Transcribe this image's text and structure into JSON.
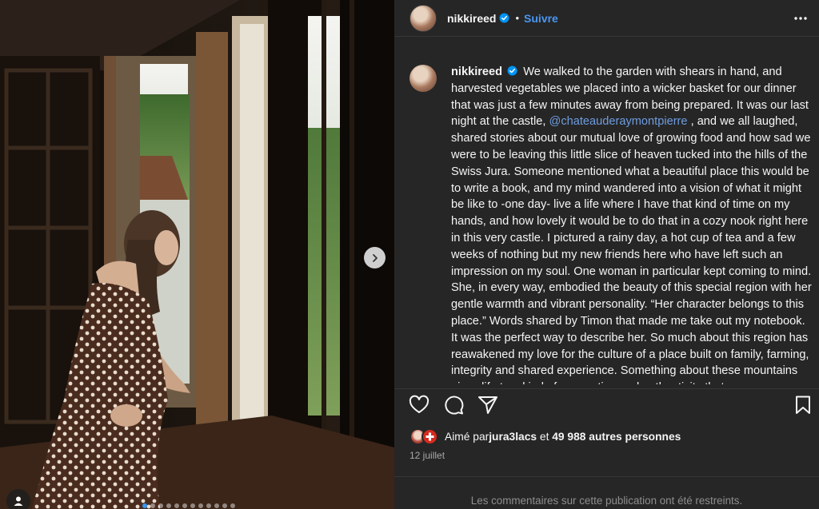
{
  "post": {
    "username": "nikkireed",
    "dot": "•",
    "follow_label": "Suivre",
    "more_icon": "more-horizontal-icon",
    "verified_icon": "verified-badge-icon"
  },
  "caption": {
    "author": "nikkireed",
    "text_before_mention": "We walked to the garden with shears in hand, and harvested vegetables we placed into a wicker basket for our dinner that was just a few minutes away from being prepared. It was our last night at the castle, ",
    "mention": "@chateauderaymontpierre",
    "text_after_mention": " , and we all laughed, shared stories about our mutual love of growing food and how sad we were to be leaving this little slice of heaven tucked into the hills of the Swiss Jura. Someone mentioned what a beautiful place this would be to write a book, and my mind wandered into a vision of what it might be like to -one day- live a life where I have that kind of time on my hands, and how lovely it would be to do that in a cozy nook right here in this very castle. I pictured a rainy day, a hot cup of tea and a few weeks of nothing but my new friends here who have left such an impression on my soul. One woman in particular kept coming to mind. She, in every way, embodied the beauty of this special region with her gentle warmth and vibrant personality. “Her character belongs to this place.” Words shared by Timon that made me take out my notebook. It was the perfect way to describe her. So much about this region has reawakened my love for the culture of a place built on family, farming, integrity and shared experience. Something about these mountains gives life to a kind of connection and authenticity that"
  },
  "actions": {
    "like_icon": "heart-icon",
    "comment_icon": "comment-icon",
    "share_icon": "send-icon",
    "save_icon": "bookmark-icon"
  },
  "likes": {
    "prefix": "Aimé par ",
    "first_liker": "jura3lacs",
    "middle": " et ",
    "others": "49 988 autres personnes"
  },
  "date": "12 juillet",
  "comments_restricted": "Les commentaires sur cette publication ont été restreints.",
  "carousel": {
    "slide_count": 12,
    "current_slide": 1,
    "next_icon": "chevron-right-icon",
    "tag_icon": "user-tag-icon"
  },
  "colors": {
    "panel_bg": "#262626",
    "accent": "#4a96f2",
    "mention": "#6e9ce0",
    "muted": "#a8a8a8"
  }
}
